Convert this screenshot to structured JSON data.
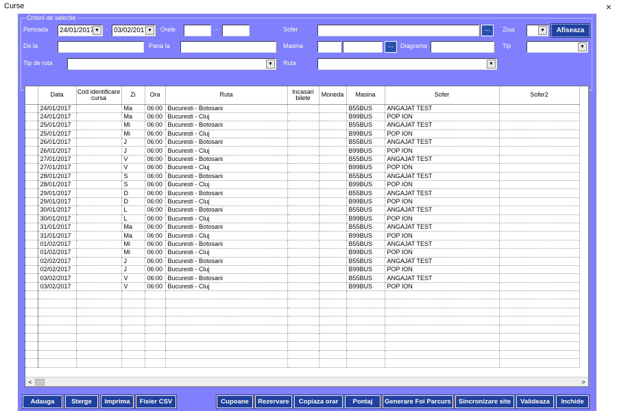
{
  "window": {
    "title": "Curse",
    "close": "×"
  },
  "criteria": {
    "group_title": "Criterii de selectie",
    "perioada_label": "Perioada",
    "date_from": "24/01/2017",
    "dash": "-",
    "date_to": "03/02/2017",
    "orele_label": "Orele",
    "ore_from": "",
    "ore_to": "",
    "sofer_label": "Sofer",
    "sofer_value": "",
    "ziua_label": "Ziua",
    "ziua_value": "",
    "afiseaza_label": "Afiseaza",
    "dela_label": "De la",
    "dela_value": "",
    "panala_label": "Pana la",
    "panala_value": "",
    "masina_label": "Masina",
    "masina_code": "",
    "masina_value": "",
    "diagrama_label": "Diagrama",
    "diagrama_value": "",
    "tip_label": "Tip",
    "tip_value": "",
    "tipruta_label": "Tip de ruta",
    "tipruta_value": "",
    "ruta_label": "Ruta",
    "ruta_value": "",
    "ellipsis": "...",
    "dropdown_arrow": "▼"
  },
  "grid": {
    "columns": [
      "Data",
      "Cod identificare cursa",
      "Zi",
      "Ora",
      "Ruta",
      "Incasari bilete",
      "Moneda",
      "Masina",
      "Sofer",
      "Sofer2"
    ],
    "rows": [
      [
        "24/01/2017",
        "",
        "Ma",
        "06:00",
        "Bucuresti - Botosani",
        "",
        "",
        "B55BUS",
        "ANGAJAT TEST",
        ""
      ],
      [
        "24/01/2017",
        "",
        "Ma",
        "06:00",
        "Bucuresti - Cluj",
        "",
        "",
        "B99BUS",
        "POP ION",
        ""
      ],
      [
        "25/01/2017",
        "",
        "Mi",
        "06:00",
        "Bucuresti - Botosani",
        "",
        "",
        "B55BUS",
        "ANGAJAT TEST",
        ""
      ],
      [
        "25/01/2017",
        "",
        "Mi",
        "06:00",
        "Bucuresti - Cluj",
        "",
        "",
        "B99BUS",
        "POP ION",
        ""
      ],
      [
        "26/01/2017",
        "",
        "J",
        "06:00",
        "Bucuresti - Botosani",
        "",
        "",
        "B55BUS",
        "ANGAJAT TEST",
        ""
      ],
      [
        "26/01/2017",
        "",
        "J",
        "06:00",
        "Bucuresti - Cluj",
        "",
        "",
        "B99BUS",
        "POP ION",
        ""
      ],
      [
        "27/01/2017",
        "",
        "V",
        "06:00",
        "Bucuresti - Botosani",
        "",
        "",
        "B55BUS",
        "ANGAJAT TEST",
        ""
      ],
      [
        "27/01/2017",
        "",
        "V",
        "06:00",
        "Bucuresti - Cluj",
        "",
        "",
        "B99BUS",
        "POP ION",
        ""
      ],
      [
        "28/01/2017",
        "",
        "S",
        "06:00",
        "Bucuresti - Botosani",
        "",
        "",
        "B55BUS",
        "ANGAJAT TEST",
        ""
      ],
      [
        "28/01/2017",
        "",
        "S",
        "06:00",
        "Bucuresti - Cluj",
        "",
        "",
        "B99BUS",
        "POP ION",
        ""
      ],
      [
        "29/01/2017",
        "",
        "D",
        "06:00",
        "Bucuresti - Botosani",
        "",
        "",
        "B55BUS",
        "ANGAJAT TEST",
        ""
      ],
      [
        "29/01/2017",
        "",
        "D",
        "06:00",
        "Bucuresti - Cluj",
        "",
        "",
        "B99BUS",
        "POP ION",
        ""
      ],
      [
        "30/01/2017",
        "",
        "L",
        "06:00",
        "Bucuresti - Botosani",
        "",
        "",
        "B55BUS",
        "ANGAJAT TEST",
        ""
      ],
      [
        "30/01/2017",
        "",
        "L",
        "06:00",
        "Bucuresti - Cluj",
        "",
        "",
        "B99BUS",
        "POP ION",
        ""
      ],
      [
        "31/01/2017",
        "",
        "Ma",
        "06:00",
        "Bucuresti - Botosani",
        "",
        "",
        "B55BUS",
        "ANGAJAT TEST",
        ""
      ],
      [
        "31/01/2017",
        "",
        "Ma",
        "06:00",
        "Bucuresti - Cluj",
        "",
        "",
        "B99BUS",
        "POP ION",
        ""
      ],
      [
        "01/02/2017",
        "",
        "Mi",
        "06:00",
        "Bucuresti - Botosani",
        "",
        "",
        "B55BUS",
        "ANGAJAT TEST",
        ""
      ],
      [
        "01/02/2017",
        "",
        "Mi",
        "06:00",
        "Bucuresti - Cluj",
        "",
        "",
        "B99BUS",
        "POP ION",
        ""
      ],
      [
        "02/02/2017",
        "",
        "J",
        "06:00",
        "Bucuresti - Botosani",
        "",
        "",
        "B55BUS",
        "ANGAJAT TEST",
        ""
      ],
      [
        "02/02/2017",
        "",
        "J",
        "06:00",
        "Bucuresti - Cluj",
        "",
        "",
        "B99BUS",
        "POP ION",
        ""
      ],
      [
        "03/02/2017",
        "",
        "V",
        "06:00",
        "Bucuresti - Botosani",
        "",
        "",
        "B55BUS",
        "ANGAJAT TEST",
        ""
      ],
      [
        "03/02/2017",
        "",
        "V",
        "06:00",
        "Bucuresti - Cluj",
        "",
        "",
        "B99BUS",
        "POP ION",
        ""
      ]
    ],
    "scroll_left": "<",
    "scroll_right": ">"
  },
  "buttons": {
    "adauga": "Adauga",
    "sterge": "Sterge",
    "imprima": "Imprima",
    "fisier_csv": "Fisier CSV",
    "cupoane": "Cupoane",
    "rezervare": "Rezervare",
    "copiaza_orar": "Copiaza orar",
    "pontaj": "Pontaj",
    "generare_foi": "Generare Foi Parcurs",
    "sincronizare": "Sincronizare site",
    "valideaza": "Valideaza",
    "inchide": "Inchide"
  },
  "colors": {
    "panel": "#8080ff",
    "button": "#2040a0",
    "dots_button": "#2850b0"
  }
}
